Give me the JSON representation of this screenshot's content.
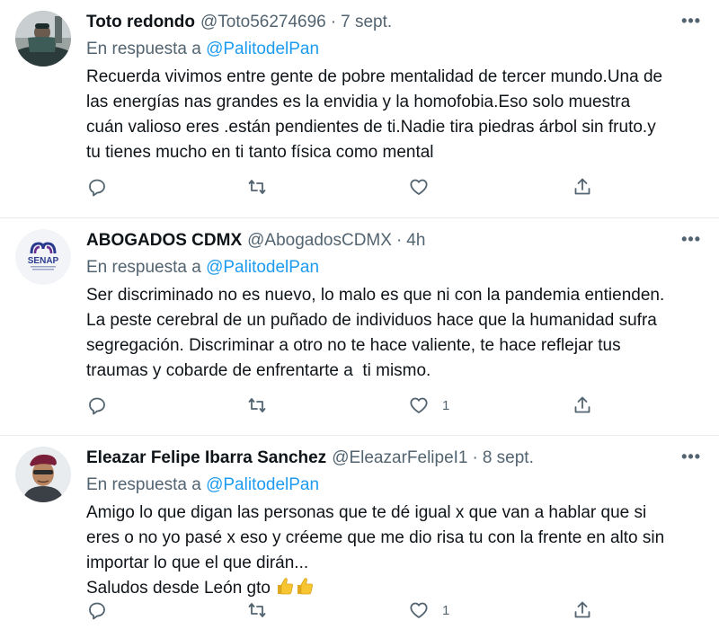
{
  "tweets": [
    {
      "name": "Toto redondo",
      "handle": "@Toto56274696",
      "sep": "·",
      "time": "7 sept.",
      "reply_prefix": "En respuesta a ",
      "reply_mention": "@PalitodelPan",
      "text": "Recuerda vivimos entre gente de pobre mentalidad de tercer mundo.Una de\nlas energías nas grandes es la envidia y la homofobia.Eso solo muestra\ncuán valioso eres .están pendientes de ti.Nadie tira piedras árbol sin fruto.y\ntu tienes mucho en ti tanto física como mental",
      "likes": ""
    },
    {
      "name": "ABOGADOS CDMX",
      "handle": "@AbogadosCDMX",
      "sep": "·",
      "time": "4h",
      "reply_prefix": "En respuesta a ",
      "reply_mention": "@PalitodelPan",
      "text": "Ser discriminado no es nuevo, lo malo es que ni con la pandemia entienden.\nLa peste cerebral de un puñado de individuos hace que la humanidad sufra\nsegregación. Discriminar a otro no te hace valiente, te hace reflejar tus\ntraumas y cobarde de enfrentarte a  ti mismo.",
      "likes": "1",
      "avatar_text": "SENAP"
    },
    {
      "name": "Eleazar Felipe Ibarra Sanchez",
      "handle": "@EleazarFelipeI1",
      "sep": "·",
      "time": "8 sept.",
      "reply_prefix": "En respuesta a ",
      "reply_mention": "@PalitodelPan",
      "text_main": "Amigo lo que digan las personas que te dé igual x que van a hablar que si\neres o no yo pasé x eso y créeme que me dio risa tu con la frente en alto sin\nimportar lo que el que dirán...\nSaludos desde León gto ",
      "likes": "1"
    }
  ],
  "colors": {
    "accent": "#1d9bf0",
    "muted": "#536471",
    "text": "#0f1419",
    "divider": "#e6ecf0"
  },
  "icons": [
    "reply-icon",
    "retweet-icon",
    "like-icon",
    "share-icon",
    "more-icon",
    "thumbs-up-emoji"
  ]
}
